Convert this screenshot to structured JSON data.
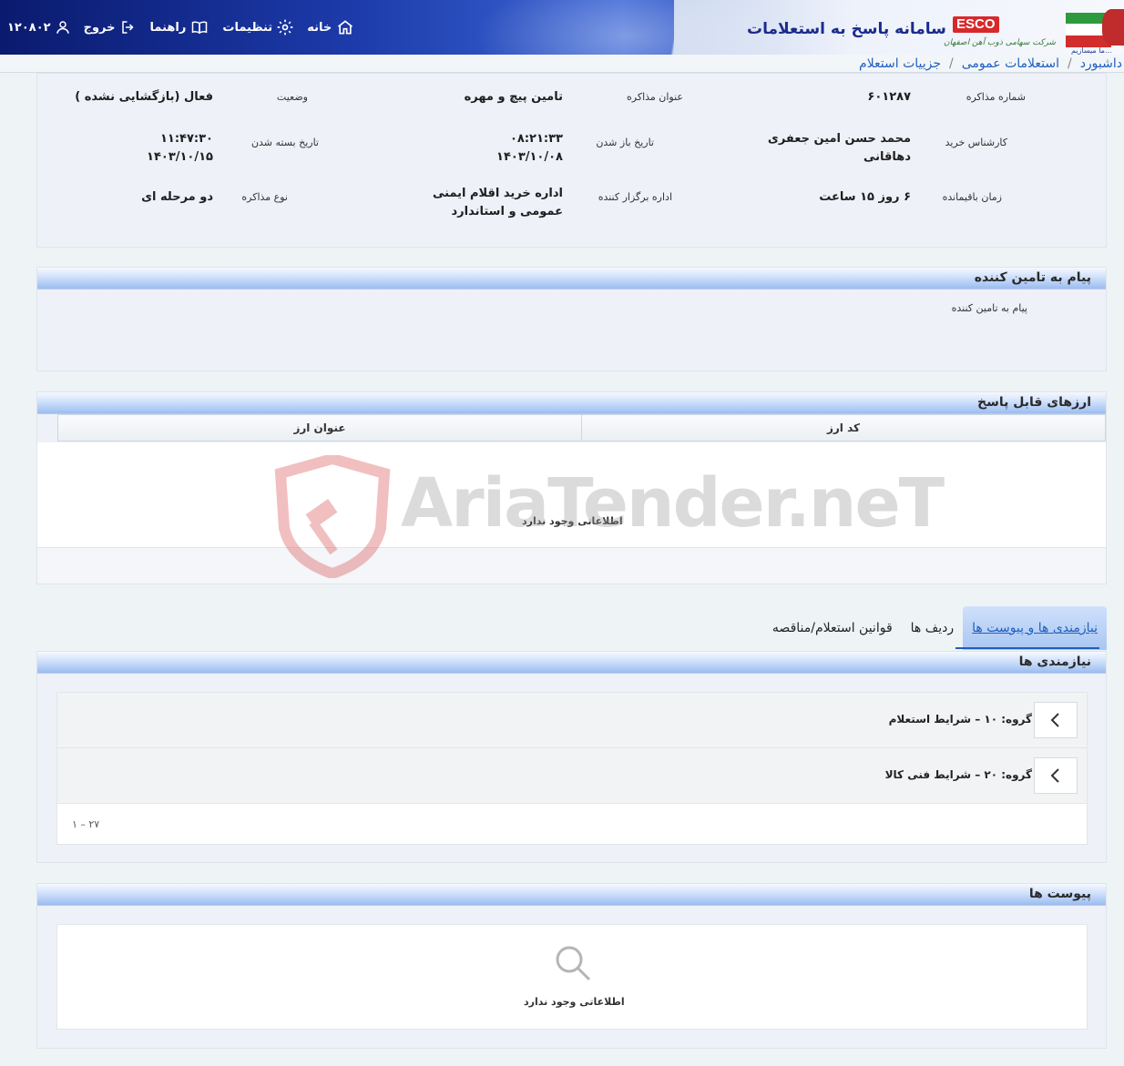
{
  "header": {
    "system_title": "سامانه پاسخ به استعلامات",
    "logo_text": "ESCO",
    "logo_subtitle": "شرکت سهامی ذوب آهن اصفهان",
    "tagline": "...ما میسازیم",
    "nav": {
      "home": "خانه",
      "settings": "تنظیمات",
      "guide": "راهنما",
      "logout": "خروج",
      "user_id": "۱۲۰۸۰۲"
    }
  },
  "breadcrumb": {
    "items": [
      "داشبورد",
      "استعلامات عمومی",
      "جزییات استعلام"
    ]
  },
  "info": {
    "negotiation_number_label": "شماره مذاکره",
    "negotiation_number": "۶۰۱۲۸۷",
    "title_label": "عنوان مذاکره",
    "title": "تامین پیچ و مهره",
    "status_label": "وضعیت",
    "status": "فعال (بازگشایی نشده )",
    "expert_label": "کارشناس خرید",
    "expert": "محمد حسن امین جعفری دهاقانی",
    "open_date_label": "تاریخ باز شدن",
    "open_time": "۰۸:۲۱:۳۳",
    "open_date": "۱۴۰۳/۱۰/۰۸",
    "close_date_label": "تاریخ بسته شدن",
    "close_time": "۱۱:۴۷:۳۰",
    "close_date": "۱۴۰۳/۱۰/۱۵",
    "remaining_label": "زمان باقیمانده",
    "remaining": "۶ روز ۱۵ ساعت",
    "organizer_label": "اداره برگزار کننده",
    "organizer": "اداره خرید اقلام ایمنی عمومی و استاندارد",
    "type_label": "نوع مذاکره",
    "type": "دو مرحله ای"
  },
  "supplier_message": {
    "title": "پیام به تامین کننده",
    "label": "پیام به تامین کننده"
  },
  "currencies": {
    "title": "ارزهای قابل پاسخ",
    "columns": [
      "کد ارز",
      "عنوان ارز"
    ],
    "empty_text": "اطلاعاتی وجود ندارد"
  },
  "watermark": "AriaTender.neT",
  "tabs": [
    {
      "label": "نیازمندی ها و پیوست ها",
      "active": true
    },
    {
      "label": "ردیف ها",
      "active": false
    },
    {
      "label": "قوانین استعلام/مناقصه",
      "active": false
    }
  ],
  "needs": {
    "title": "نیازمندی ها",
    "groups": [
      {
        "label": "گروه: ۱۰ – شرایط استعلام"
      },
      {
        "label": "گروه: ۲۰ – شرایط فنی کالا"
      }
    ],
    "pager": "۱ – ۲۷"
  },
  "attachments": {
    "title": "پیوست ها",
    "empty_text": "اطلاعاتی وجود ندارد"
  },
  "colors": {
    "accent": "#1f5fc3",
    "header_dark": "#0b1d7a",
    "panel_head": "#9cbdf0",
    "logo_red": "#d8282a"
  }
}
